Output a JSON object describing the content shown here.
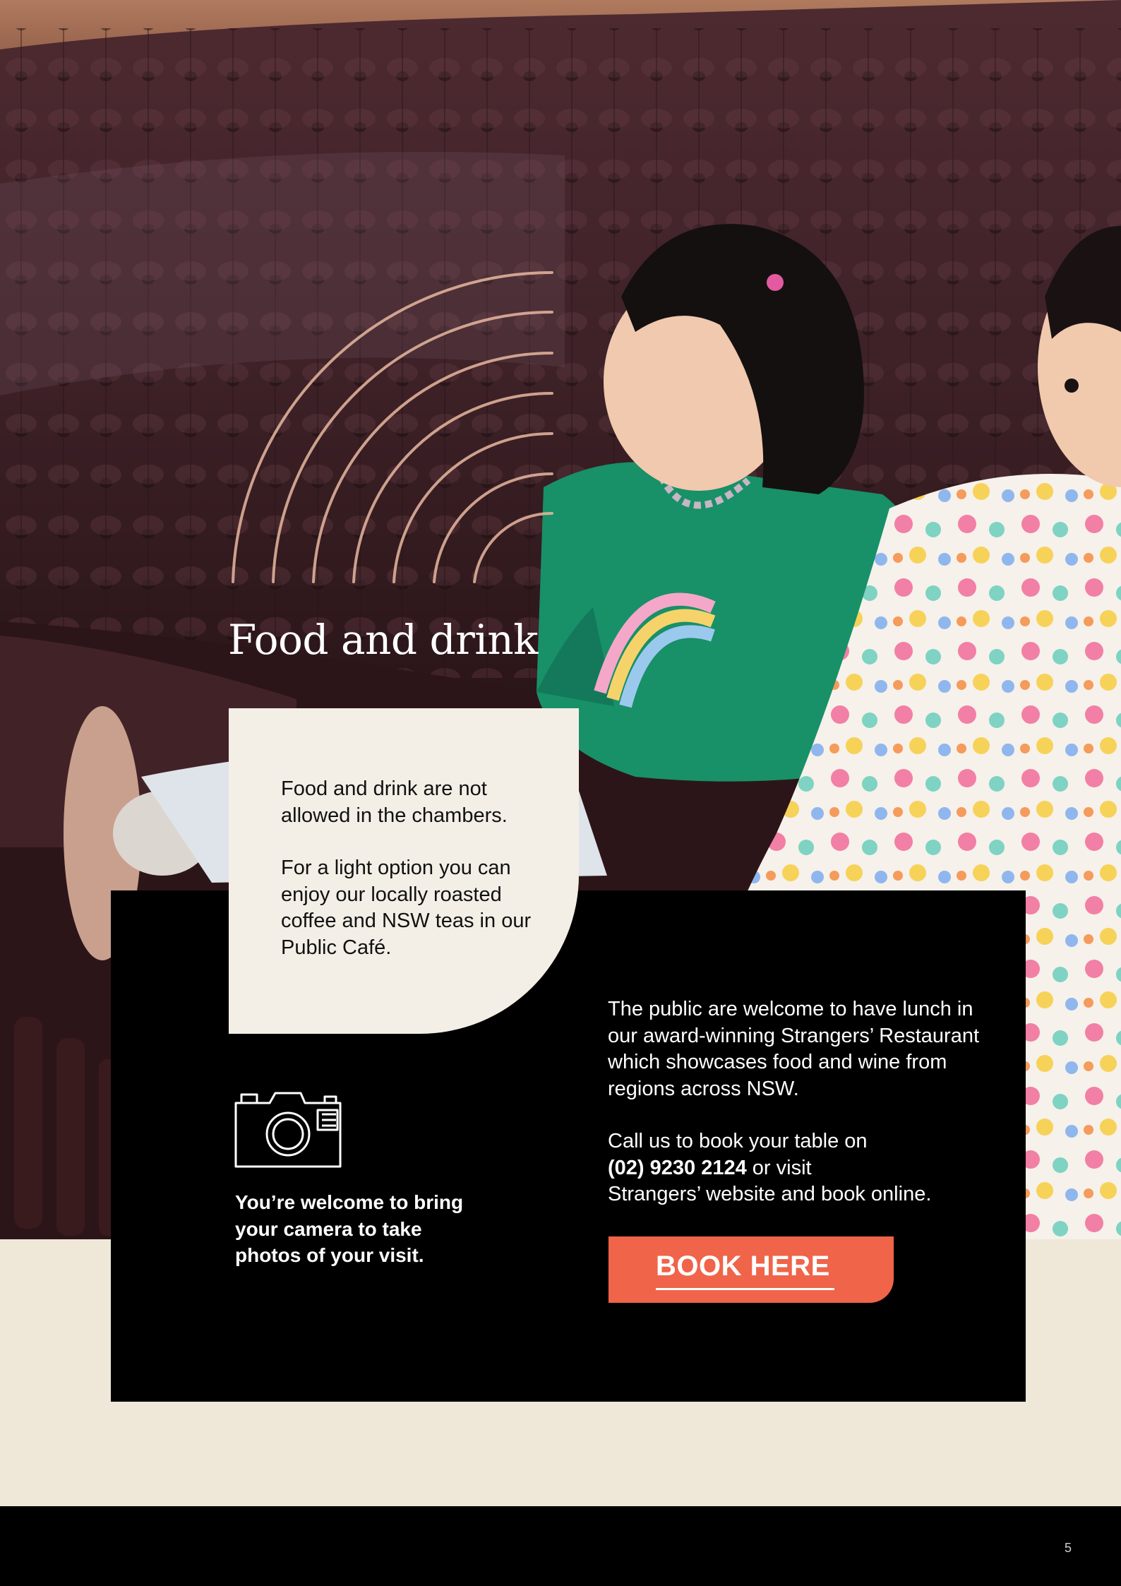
{
  "page": {
    "title": "Food and drink",
    "page_number": "5"
  },
  "callout": {
    "paragraph_1": "Food and drink are not allowed in the chambers.",
    "paragraph_2": "For a light option you can enjoy our locally roasted coffee and NSW teas in our Public Café."
  },
  "camera": {
    "icon": "camera-icon",
    "text": "You’re welcome to bring your camera to take photos of your visit."
  },
  "restaurant": {
    "paragraph_1": "The public are welcome to have lunch in our award-winning Strangers’ Restaurant which showcases food and wine from regions across NSW.",
    "call_prefix": "Call us to book your table on",
    "phone": "(02) 9230 2124",
    "call_middle": "or visit",
    "call_suffix": "Strangers’ website and book online."
  },
  "book_button": {
    "label": "BOOK HERE"
  },
  "colors": {
    "accent": "#f06449",
    "cream": "#f4efe6",
    "background": "#efe8d9",
    "panel": "#000000"
  }
}
